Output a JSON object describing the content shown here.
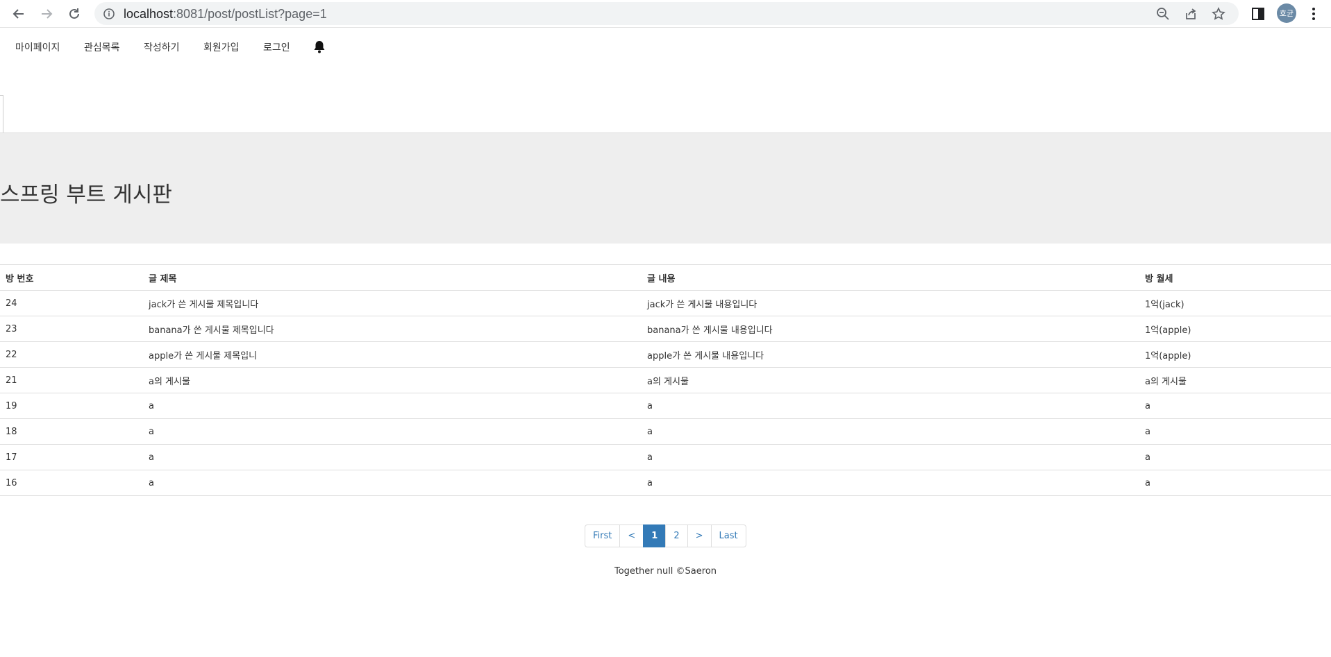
{
  "browser": {
    "url_host": "localhost",
    "url_rest": ":8081/post/postList?page=1",
    "profile_initials": "호균"
  },
  "nav": {
    "items": [
      "마이페이지",
      "관심목록",
      "작성하기",
      "회원가입",
      "로그인"
    ],
    "bell_icon": "bell-icon"
  },
  "header": {
    "title": "스프링 부트 게시판"
  },
  "table": {
    "headers": [
      "방 번호",
      "글 제목",
      "글 내용",
      "방 월세"
    ],
    "rows": [
      [
        "24",
        "jack가 쓴 게시물 제목입니다",
        "jack가 쓴 게시물 내용입니다",
        "1억(jack)"
      ],
      [
        "23",
        "banana가 쓴 게시물 제목입니다",
        "banana가 쓴 게시물 내용입니다",
        "1억(apple)"
      ],
      [
        "22",
        "apple가 쓴 게시물 제목입니",
        "apple가 쓴 게시물 내용입니다",
        "1억(apple)"
      ],
      [
        "21",
        "a의 게시물",
        "a의 게시물",
        "a의 게시물"
      ],
      [
        "19",
        "a",
        "a",
        "a"
      ],
      [
        "18",
        "a",
        "a",
        "a"
      ],
      [
        "17",
        "a",
        "a",
        "a"
      ],
      [
        "16",
        "a",
        "a",
        "a"
      ]
    ]
  },
  "pagination": {
    "first": "First",
    "prev": "<",
    "pages": [
      "1",
      "2"
    ],
    "active_page": "1",
    "next": ">",
    "last": "Last"
  },
  "footer": {
    "text": "Together null ©Saeron"
  },
  "colors": {
    "accent": "#337ab7",
    "jumbotron_bg": "#eeeeee"
  }
}
